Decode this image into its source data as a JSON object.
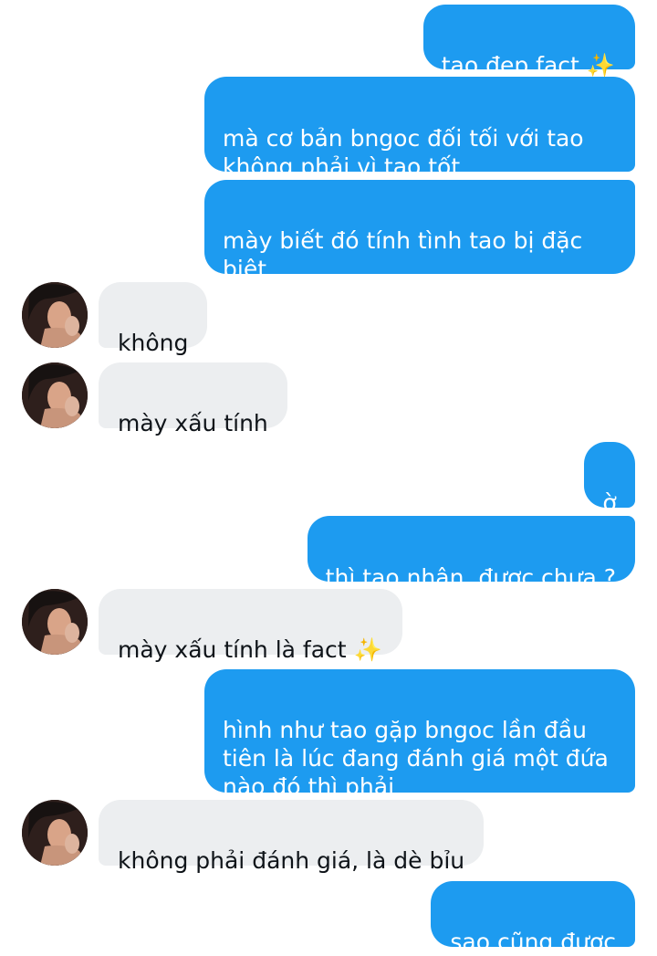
{
  "messages": [
    {
      "text": "tao đẹp fact",
      "sparkle": "✨"
    },
    {
      "text": "mà cơ bản bngoc đối tối với tao\nkhông phải vì tao tốt"
    },
    {
      "text": "mày biết đó tính tình tao bị đặc\nbiệt"
    },
    {
      "text": "không"
    },
    {
      "text": "mày xấu tính"
    },
    {
      "text": "ờ"
    },
    {
      "text": "thì tao nhận, được chưa ?"
    },
    {
      "text": "mày xấu tính là fact",
      "sparkle": "✨"
    },
    {
      "text": "hình như tao gặp bngoc lần đầu\ntiên là lúc đang đánh giá một đứa\nnào đó thì phải"
    },
    {
      "text": "không phải đánh giá, là dè bỉu"
    },
    {
      "text": "sao cũng được"
    }
  ],
  "colors": {
    "outgoing": "#1d9bf0",
    "incoming": "#eceef0",
    "outgoing_text": "#ffffff",
    "incoming_text": "#0f1419"
  },
  "icons": {
    "sparkle": "sparkles-emoji",
    "avatar": "user-avatar"
  }
}
